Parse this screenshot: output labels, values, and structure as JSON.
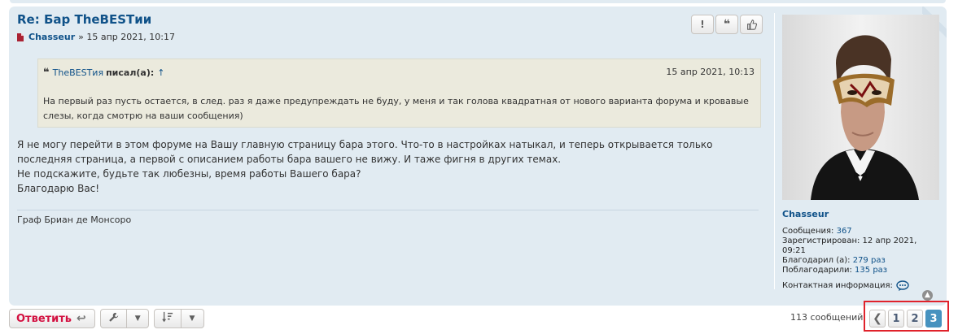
{
  "post": {
    "title": "Re: Бар TheBESTии",
    "author": "Chasseur",
    "date": "» 15 апр 2021, 10:17",
    "buttons": {
      "report": "!",
      "quote": "❝",
      "like": "👍"
    },
    "quote": {
      "author": "TheBESTия",
      "label": "писал(а):",
      "up": "↑",
      "date": "15 апр 2021, 10:13",
      "text": "На первый раз пусть остается, в след. раз я даже предупреждать не буду, у меня и так голова квадратная от нового варианта форума и кровавые слезы, когда смотрю на ваши сообщения)"
    },
    "content": [
      "Я не могу перейти в этом форуме на Вашу главную страницу бара этого. Что-то в настройках натыкал, и теперь открывается только последняя страница, а первой с описанием работы бара вашего не вижу. И таже фигня в других темах.",
      "Не подскажите, будьте так любезны, время работы Вашего бара?",
      "Благодарю Вас!"
    ],
    "signature": "Граф Бриан де Монсоро"
  },
  "profile": {
    "name": "Chasseur",
    "posts_label": "Сообщения:",
    "posts_value": "367",
    "registered_label": "Зарегистрирован:",
    "registered_value": "12 апр 2021, 09:21",
    "thanked_label": "Благодарил (а):",
    "thanked_value": "279 раз",
    "thanked_by_label": "Поблагодарили:",
    "thanked_by_value": "135 раз",
    "contact_label": "Контактная информация:"
  },
  "bottom": {
    "reply_label": "Ответить",
    "total": "113 сообщений",
    "pages": [
      "1",
      "2",
      "3"
    ],
    "current_page": "3"
  },
  "colors": {
    "link": "#105289",
    "post_bg": "#e1ebf2",
    "quote_bg": "#ebeadd",
    "reply": "#d31141",
    "current_page": "#4692bf",
    "highlight": "#e0222b"
  }
}
